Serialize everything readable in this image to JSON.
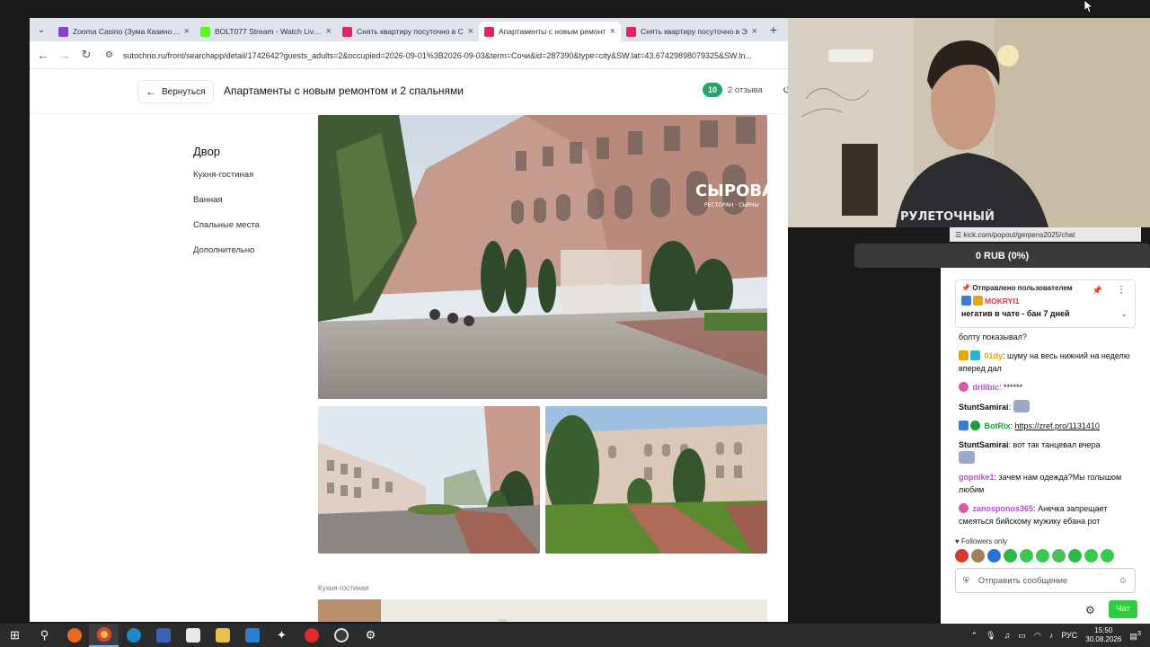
{
  "browser": {
    "tabs": [
      {
        "title": "Zooma Casino (Зума Казино) о",
        "color": "#8b3fd1",
        "active": false
      },
      {
        "title": "BOLT077 Stream - Watch Live o",
        "color": "#53fc18",
        "active": false
      },
      {
        "title": "Снять квартиру посуточно в С",
        "color": "#e0245e",
        "active": false
      },
      {
        "title": "Апартаменты с новым ремонт",
        "color": "#e0245e",
        "active": true
      },
      {
        "title": "Снять квартиру посуточно в Э",
        "color": "#e0245e",
        "active": false
      }
    ],
    "url": "sutochno.ru/front/searchapp/detail/1742642?guests_adults=2&occupied=2026-09-01%3B2026-09-03&term=Сочи&id=287390&type=city&SW.lat=43.67429898079325&SW.ln..."
  },
  "page": {
    "back_label": "Вернуться",
    "title": "Апартаменты с новым ремонтом и 2 спальнями",
    "rating": "10",
    "reviews": "2 отзыва",
    "side_nav": {
      "heading": "Двор",
      "items": [
        "Кухня-гостиная",
        "Ванная",
        "Спальные места",
        "Дополнительно"
      ]
    },
    "section_caption": "Кухня-гостиная",
    "photo_sign": "СЫРОВАРНЯ",
    "photo_sign_sub": "РЕСТОРАН · СЫРНЫ"
  },
  "stream": {
    "shirt_text": "РУЛЕТОЧНЫЙ",
    "chat_url": "☰ kick.com/popout/gerpens2025/chat",
    "donation": "0 RUB (0%)",
    "pinned": {
      "by": "Отправлено пользователем",
      "user": "MOKRYI1",
      "message": "негатив в чате - бан 7 дней"
    },
    "messages": [
      {
        "user": "",
        "text": "болту показывал?",
        "color": "#111"
      },
      {
        "user": "01dy",
        "text": "шуму на весь нижний на неделю вперед дал",
        "color": "#e6a700"
      },
      {
        "user": "drillbic",
        "text": "******",
        "color": "#b04fd6"
      },
      {
        "user": "StuntSamirai",
        "text": "",
        "color": "#111",
        "emote": true
      },
      {
        "user": "BotRix",
        "text": "https://zref.pro/1131410",
        "color": "#1c9e3e",
        "link": true
      },
      {
        "user": "StuntSamirai",
        "text": "вот так танцевал вчера",
        "color": "#111",
        "emote": true
      },
      {
        "user": "gopnike1",
        "text": "зачем нам одежда?Мы голышом любим",
        "color": "#b04fd6"
      },
      {
        "user": "zanosponos365",
        "text": "Анечка запрещает смеяться бийскому мужику ебана рот",
        "color": "#b04fd6"
      }
    ],
    "followers_only": "Followers only",
    "input_placeholder": "Отправить сообщение",
    "chat_button": "Чат"
  },
  "taskbar": {
    "lang": "РУС",
    "time": "15:50",
    "date": "30.08.2026",
    "notifications": "3"
  }
}
